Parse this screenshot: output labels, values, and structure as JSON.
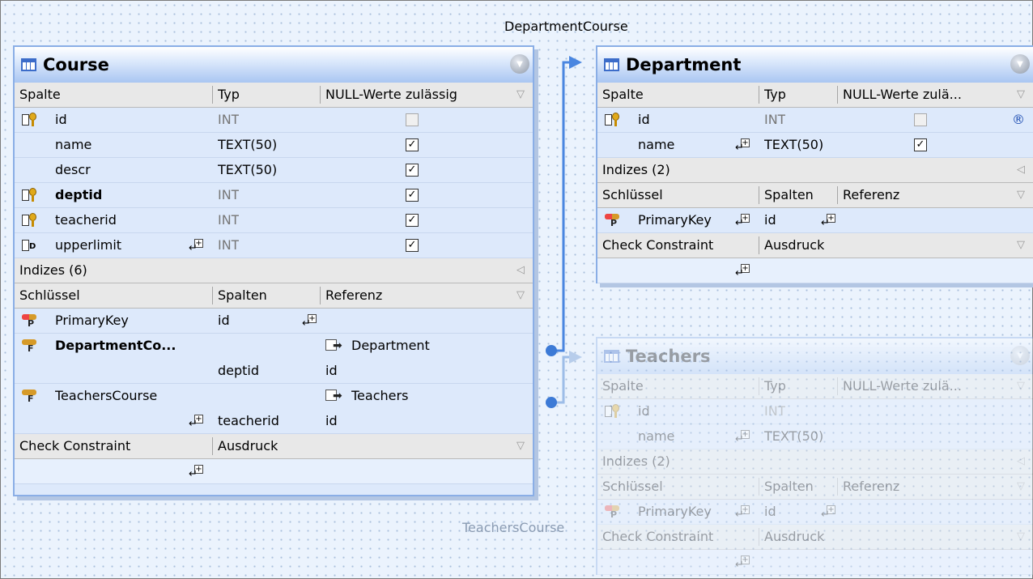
{
  "relations": {
    "top_label": "DepartmentCourse",
    "bottom_label": "TeachersCourse"
  },
  "course": {
    "title": "Course",
    "headers": [
      "Spalte",
      "Typ",
      "NULL-Werte zulässig"
    ],
    "columns": [
      {
        "name": "id",
        "type": "INT",
        "nullable": false,
        "bold": false,
        "icon": "primary-key-column-icon"
      },
      {
        "name": "name",
        "type": "TEXT(50)",
        "nullable": true,
        "bold": false,
        "icon": ""
      },
      {
        "name": "descr",
        "type": "TEXT(50)",
        "nullable": true,
        "bold": false,
        "icon": ""
      },
      {
        "name": "deptid",
        "type": "INT",
        "nullable": true,
        "bold": true,
        "icon": "foreign-key-column-icon"
      },
      {
        "name": "teacherid",
        "type": "INT",
        "nullable": true,
        "bold": false,
        "icon": "foreign-key-column-icon"
      },
      {
        "name": "upperlimit",
        "type": "INT",
        "nullable": true,
        "bold": false,
        "icon": "check-column-icon"
      }
    ],
    "indexes_label": "Indizes (6)",
    "key_headers": [
      "Schlüssel",
      "Spalten",
      "Referenz"
    ],
    "keys": {
      "primary": {
        "name": "PrimaryKey",
        "column": "id"
      },
      "fk1": {
        "name": "DepartmentCo...",
        "column": "deptid",
        "ref_table": "Department",
        "ref_column": "id"
      },
      "fk2": {
        "name": "TeachersCourse",
        "column": "teacherid",
        "ref_table": "Teachers",
        "ref_column": "id"
      }
    },
    "check_headers": [
      "Check Constraint",
      "Ausdruck"
    ]
  },
  "department": {
    "title": "Department",
    "headers": [
      "Spalte",
      "Typ",
      "NULL-Werte zulä..."
    ],
    "columns": [
      {
        "name": "id",
        "type": "INT",
        "nullable": false
      },
      {
        "name": "name",
        "type": "TEXT(50)",
        "nullable": true
      }
    ],
    "indexes_label": "Indizes (2)",
    "key_headers": [
      "Schlüssel",
      "Spalten",
      "Referenz"
    ],
    "primary": {
      "name": "PrimaryKey",
      "column": "id"
    },
    "check_headers": [
      "Check Constraint",
      "Ausdruck"
    ]
  },
  "teachers": {
    "title": "Teachers",
    "headers": [
      "Spalte",
      "Typ",
      "NULL-Werte zulä..."
    ],
    "columns": [
      {
        "name": "id",
        "type": "INT"
      },
      {
        "name": "name",
        "type": "TEXT(50)"
      }
    ],
    "indexes_label": "Indizes (2)",
    "key_headers": [
      "Schlüssel",
      "Spalten",
      "Referenz"
    ],
    "primary": {
      "name": "PrimaryKey",
      "column": "id"
    },
    "check_headers": [
      "Check Constraint",
      "Ausdruck"
    ]
  },
  "colors": {
    "accent": "#3c7ad6",
    "canvas": "#ebf3fd",
    "table_border": "#8aaee6"
  }
}
